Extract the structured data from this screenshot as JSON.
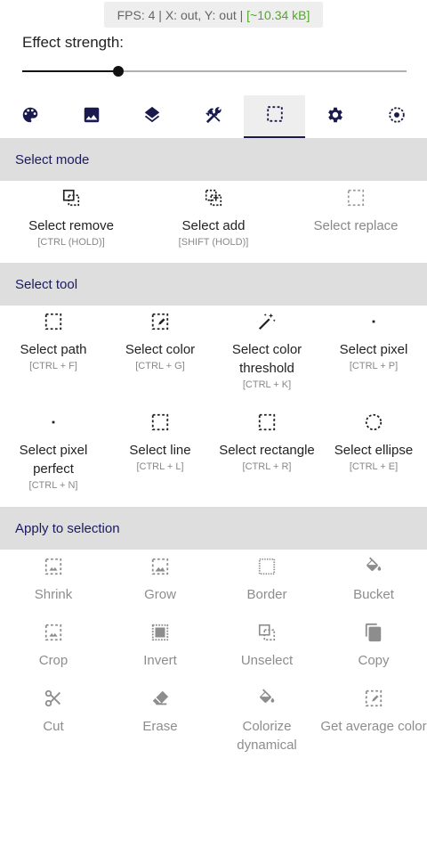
{
  "status": {
    "fps": "FPS: 4",
    "coords": "X: out, Y: out",
    "memory": "[~10.34 kB]",
    "separator": "|"
  },
  "effect": {
    "label": "Effect strength:",
    "value_fraction": 0.25
  },
  "tabs": [
    {
      "icon": "palette-icon",
      "name": "tab-palette"
    },
    {
      "icon": "image-icon",
      "name": "tab-image"
    },
    {
      "icon": "layers-icon",
      "name": "tab-layers"
    },
    {
      "icon": "tools-icon",
      "name": "tab-tools"
    },
    {
      "icon": "selection-icon",
      "name": "tab-selection",
      "active": true
    },
    {
      "icon": "settings-icon",
      "name": "tab-settings"
    },
    {
      "icon": "target-icon",
      "name": "tab-target"
    }
  ],
  "select_mode": {
    "title": "Select mode",
    "items": [
      {
        "label": "Select remove",
        "shortcut": "[CTRL (HOLD)]",
        "icon": "select-remove-icon"
      },
      {
        "label": "Select add",
        "shortcut": "[SHIFT (HOLD)]",
        "icon": "select-add-icon"
      },
      {
        "label": "Select replace",
        "shortcut": "",
        "icon": "select-replace-icon"
      }
    ]
  },
  "select_tool": {
    "title": "Select tool",
    "items": [
      {
        "label": "Select path",
        "shortcut": "[CTRL + F]",
        "icon": "dashed-square-icon"
      },
      {
        "label": "Select color",
        "shortcut": "[CTRL + G]",
        "icon": "select-color-icon"
      },
      {
        "label": "Select color threshold",
        "shortcut": "[CTRL + K]",
        "icon": "magic-wand-icon"
      },
      {
        "label": "Select pixel",
        "shortcut": "[CTRL + P]",
        "icon": "pixel-icon"
      },
      {
        "label": "Select pixel perfect",
        "shortcut": "[CTRL + N]",
        "icon": "pixel-perfect-icon"
      },
      {
        "label": "Select line",
        "shortcut": "[CTRL + L]",
        "icon": "dashed-line-icon"
      },
      {
        "label": "Select rectangle",
        "shortcut": "[CTRL + R]",
        "icon": "dashed-rectangle-icon"
      },
      {
        "label": "Select ellipse",
        "shortcut": "[CTRL + E]",
        "icon": "dashed-circle-icon"
      }
    ]
  },
  "apply": {
    "title": "Apply to selection",
    "items": [
      {
        "label": "Shrink",
        "icon": "shrink-icon"
      },
      {
        "label": "Grow",
        "icon": "grow-icon"
      },
      {
        "label": "Border",
        "icon": "border-icon"
      },
      {
        "label": "Bucket",
        "icon": "bucket-icon"
      },
      {
        "label": "Crop",
        "icon": "crop-icon"
      },
      {
        "label": "Invert",
        "icon": "invert-icon"
      },
      {
        "label": "Unselect",
        "icon": "unselect-icon"
      },
      {
        "label": "Copy",
        "icon": "copy-icon"
      },
      {
        "label": "Cut",
        "icon": "scissors-icon"
      },
      {
        "label": "Erase",
        "icon": "eraser-icon"
      },
      {
        "label": "Colorize dynamical",
        "icon": "colorize-icon"
      },
      {
        "label": "Get average color",
        "icon": "average-color-icon"
      }
    ]
  },
  "colors": {
    "accent": "#1a1a5e",
    "memory": "#55a52f",
    "header_bg": "#dedede"
  }
}
